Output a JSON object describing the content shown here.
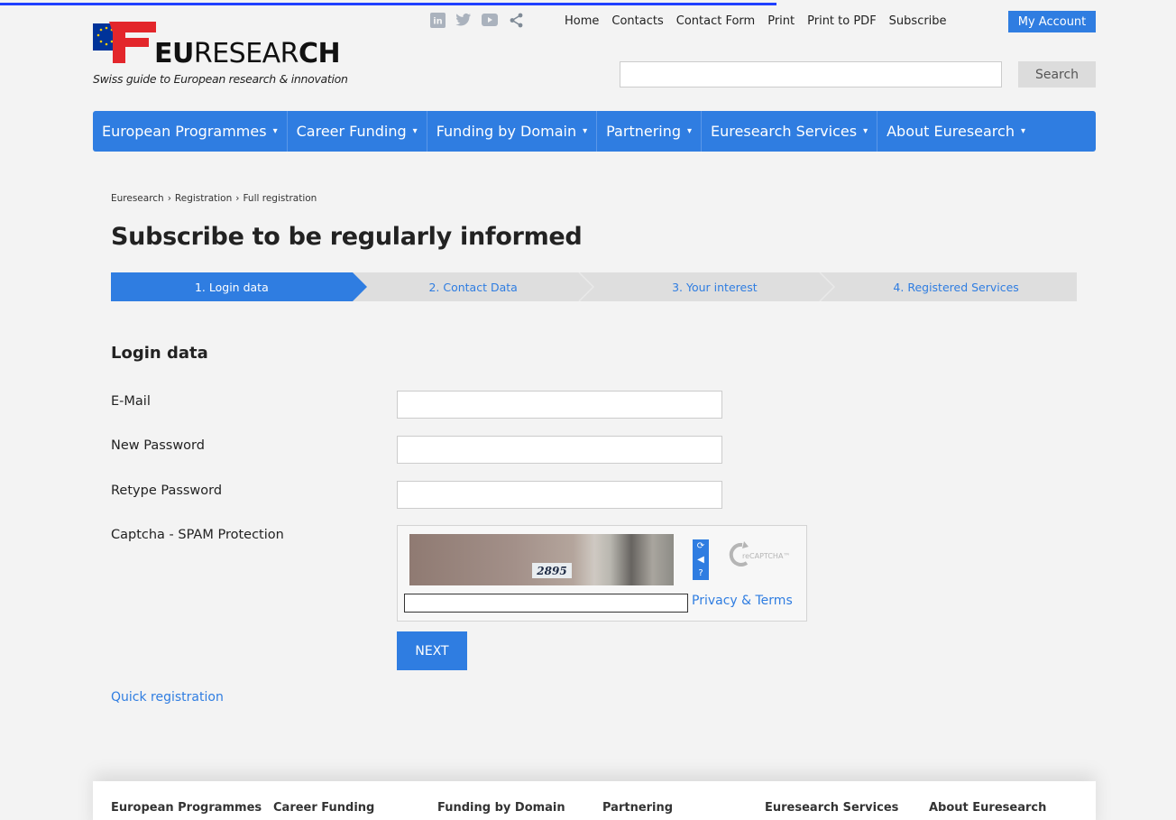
{
  "header": {
    "logo_text_bold": "EU",
    "logo_text_regular": "RESEAR",
    "logo_text_tail": "CH",
    "tagline": "Swiss guide to European research & innovation",
    "social_icons": [
      "linkedin-icon",
      "twitter-icon",
      "youtube-icon",
      "share-icon"
    ],
    "top_links": [
      "Home",
      "Contacts",
      "Contact Form",
      "Print",
      "Print to PDF",
      "Subscribe"
    ],
    "account_label": "My Account",
    "search_button": "Search",
    "search_value": ""
  },
  "nav": {
    "items": [
      "European Programmes",
      "Career Funding",
      "Funding by Domain",
      "Partnering",
      "Euresearch Services",
      "About Euresearch"
    ],
    "caret": "▾"
  },
  "breadcrumb": {
    "items": [
      "Euresearch",
      "Registration",
      "Full registration"
    ],
    "separator": "›"
  },
  "page_title": "Subscribe to be regularly informed",
  "steps": [
    {
      "label": "1. Login data",
      "active": true
    },
    {
      "label": "2. Contact Data",
      "active": false
    },
    {
      "label": "3. Your interest",
      "active": false
    },
    {
      "label": "4. Registered Services",
      "active": false
    }
  ],
  "form": {
    "section_title": "Login data",
    "fields": [
      {
        "label": "E-Mail",
        "value": ""
      },
      {
        "label": "New Password",
        "value": ""
      },
      {
        "label": "Retype Password",
        "value": ""
      }
    ],
    "captcha_label": "Captcha - SPAM Protection",
    "captcha_number": "2895",
    "captcha_brand": "reCAPTCHA™",
    "privacy_link": "Privacy & Terms",
    "next_button": "NEXT",
    "quick_registration": "Quick registration"
  },
  "footer": {
    "columns": [
      "European Programmes",
      "Career Funding",
      "Funding by Domain",
      "Partnering",
      "Euresearch Services",
      "About Euresearch"
    ]
  },
  "colors": {
    "accent": "#2f7de1",
    "background": "#f3f3f3",
    "logo_red": "#e3262b"
  }
}
